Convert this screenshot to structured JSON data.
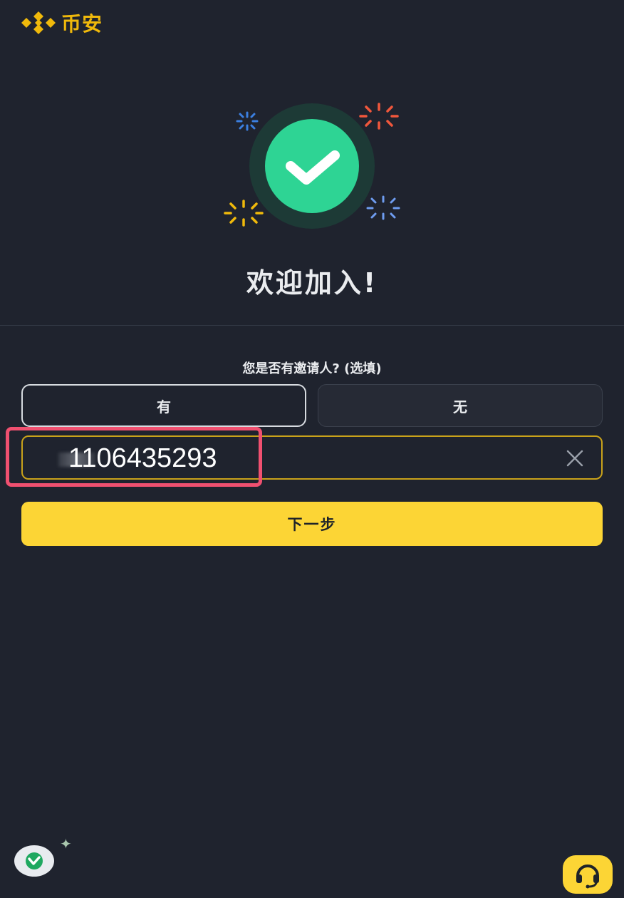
{
  "brand": {
    "name": "币安",
    "color": "#f0b90b"
  },
  "hero": {
    "icon": "check-circle-icon",
    "title": "欢迎加入!"
  },
  "referral": {
    "question": "您是否有邀请人? (选填)",
    "options": [
      {
        "label": "有",
        "selected": true
      },
      {
        "label": "无",
        "selected": false
      }
    ],
    "input_value": "1106435293",
    "clear_icon": "close-icon"
  },
  "actions": {
    "next_label": "下一步"
  },
  "floating": {
    "left_badge_icon": "vpn-badge-icon",
    "support_icon": "headset-icon"
  },
  "colors": {
    "background": "#1f232e",
    "accent": "#fcd535",
    "highlight": "#f05070",
    "success": "#2ed494"
  }
}
